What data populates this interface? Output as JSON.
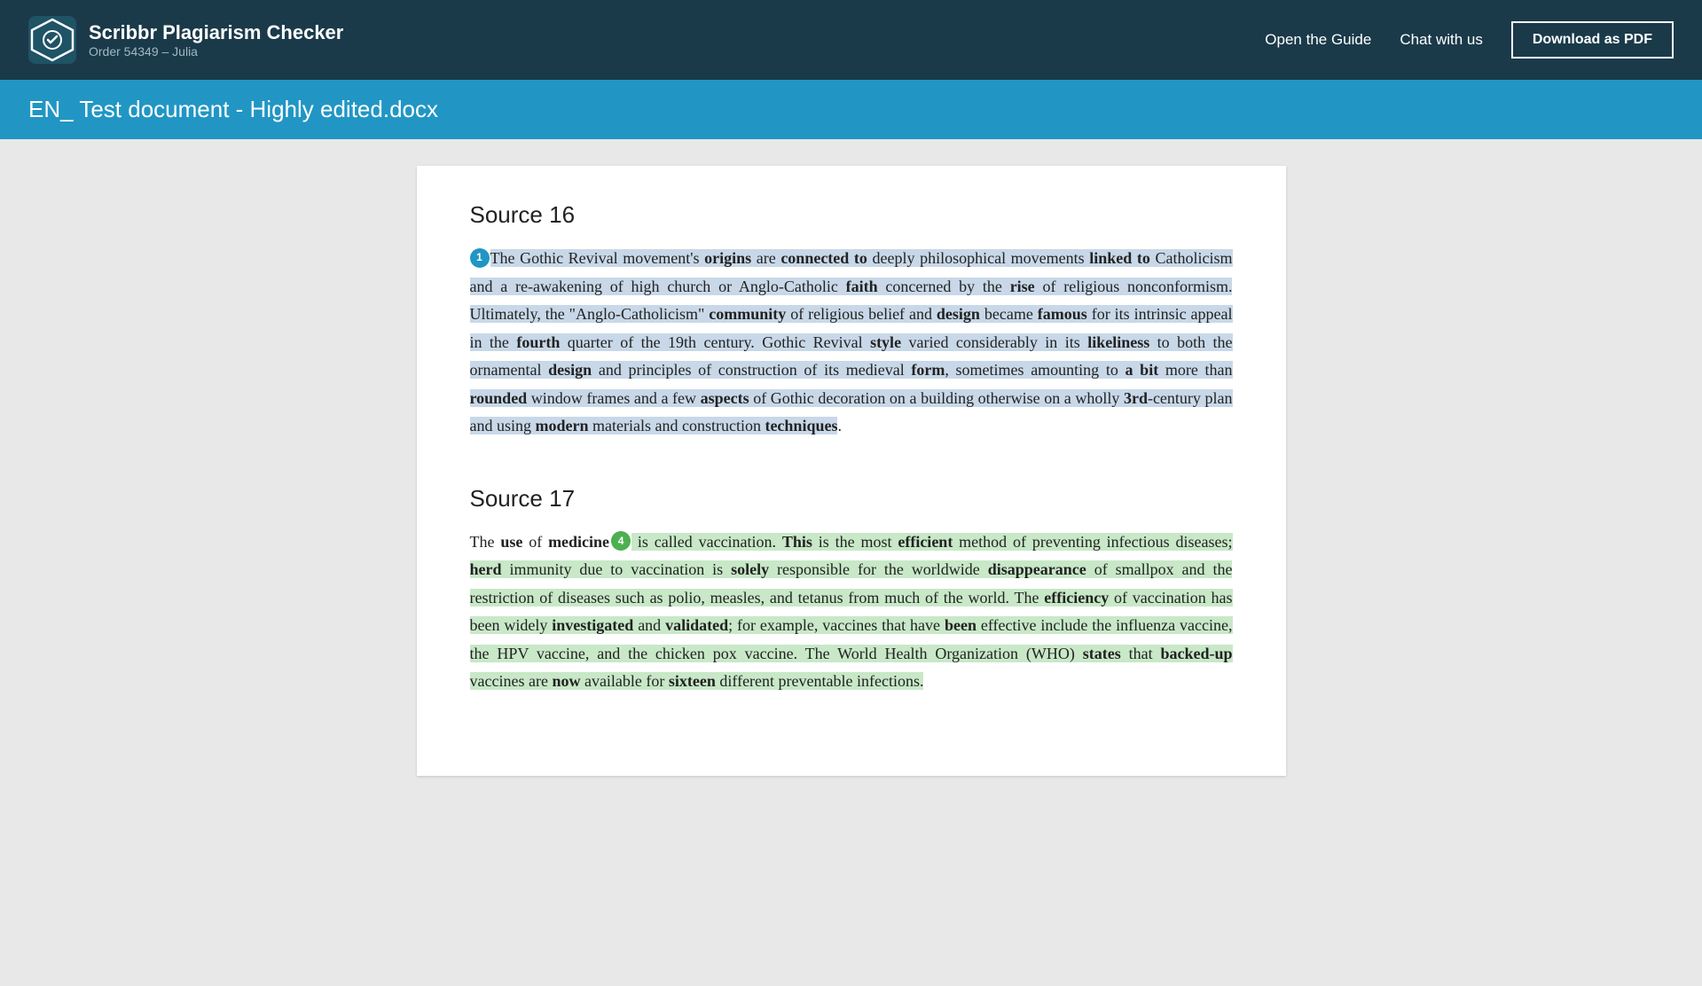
{
  "header": {
    "logo_title": "Scribbr Plagiarism Checker",
    "logo_subtitle": "Order 54349 – Julia",
    "nav": {
      "guide_label": "Open the Guide",
      "chat_label": "Chat with us",
      "download_label": "Download as PDF"
    }
  },
  "blue_bar": {
    "title": "EN_ Test document - Highly edited.docx"
  },
  "sources": [
    {
      "id": "source16",
      "heading": "Source 16",
      "badge_number": "1",
      "badge_type": "blue",
      "paragraph_parts": [
        {
          "text": "The Gothic Revival movement's ",
          "style": "hl-blue"
        },
        {
          "text": "origins",
          "style": "hl-blue bold"
        },
        {
          "text": " are ",
          "style": "hl-blue"
        },
        {
          "text": "connected to",
          "style": "hl-blue bold"
        },
        {
          "text": " deeply philosophical movements ",
          "style": "hl-blue"
        },
        {
          "text": "linked to",
          "style": "hl-blue bold"
        },
        {
          "text": " Catholicism and a re-awakening of high church or Anglo-Catholic ",
          "style": "hl-blue"
        },
        {
          "text": "faith",
          "style": "hl-blue bold"
        },
        {
          "text": " concerned by the ",
          "style": "hl-blue"
        },
        {
          "text": "rise",
          "style": "hl-blue bold"
        },
        {
          "text": " of religious nonconformism. Ultimately, the \"Anglo-Catholicism\" ",
          "style": "hl-blue"
        },
        {
          "text": "community",
          "style": "hl-blue bold"
        },
        {
          "text": " of religious belief and ",
          "style": "hl-blue"
        },
        {
          "text": "design",
          "style": "hl-blue bold"
        },
        {
          "text": " became ",
          "style": "hl-blue"
        },
        {
          "text": "famous",
          "style": "hl-blue bold"
        },
        {
          "text": " for its intrinsic appeal in the ",
          "style": "hl-blue"
        },
        {
          "text": "fourth",
          "style": "hl-blue bold"
        },
        {
          "text": " quarter of the 19th century. Gothic Revival ",
          "style": "hl-blue"
        },
        {
          "text": "style",
          "style": "hl-blue bold"
        },
        {
          "text": " varied considerably in its ",
          "style": "hl-blue"
        },
        {
          "text": "likeliness",
          "style": "hl-blue bold"
        },
        {
          "text": " to both the ornamental ",
          "style": "hl-blue"
        },
        {
          "text": "design",
          "style": "hl-blue bold"
        },
        {
          "text": " and principles of construction of its medieval ",
          "style": "hl-blue"
        },
        {
          "text": "form",
          "style": "hl-blue bold"
        },
        {
          "text": ", sometimes amounting to ",
          "style": "hl-blue"
        },
        {
          "text": "a bit",
          "style": "hl-blue bold"
        },
        {
          "text": " more than ",
          "style": "hl-blue"
        },
        {
          "text": "rounded",
          "style": "hl-blue bold"
        },
        {
          "text": " window frames and a few ",
          "style": "hl-blue"
        },
        {
          "text": "aspects",
          "style": "hl-blue bold"
        },
        {
          "text": " of Gothic decoration on a building otherwise on a wholly ",
          "style": "hl-blue"
        },
        {
          "text": "3rd",
          "style": "hl-blue bold"
        },
        {
          "text": "-century plan and using ",
          "style": "hl-blue"
        },
        {
          "text": "modern",
          "style": "hl-blue bold"
        },
        {
          "text": " materials and construction ",
          "style": "hl-blue"
        },
        {
          "text": "techniques",
          "style": "hl-blue bold"
        },
        {
          "text": ".",
          "style": "normal"
        }
      ]
    },
    {
      "id": "source17",
      "heading": "Source 17",
      "badge_number": "4",
      "badge_type": "green",
      "paragraph_parts": [
        {
          "text": "The ",
          "style": "normal"
        },
        {
          "text": "use",
          "style": "normal bold"
        },
        {
          "text": " of ",
          "style": "normal"
        },
        {
          "text": "medicine",
          "style": "normal bold"
        },
        {
          "text": " is called vaccination. ",
          "style": "hl-green"
        },
        {
          "text": "This",
          "style": "hl-green bold"
        },
        {
          "text": " is the most ",
          "style": "hl-green"
        },
        {
          "text": "efficient",
          "style": "hl-green bold"
        },
        {
          "text": " method of preventing infectious diseases; ",
          "style": "hl-green"
        },
        {
          "text": "herd",
          "style": "hl-green bold"
        },
        {
          "text": " immunity due to vaccination is ",
          "style": "hl-green"
        },
        {
          "text": "solely",
          "style": "hl-green bold"
        },
        {
          "text": " responsible for the worldwide ",
          "style": "hl-green"
        },
        {
          "text": "disappearance",
          "style": "hl-green bold"
        },
        {
          "text": " of smallpox and the restriction of diseases such as polio, measles, and tetanus from much of the world. The ",
          "style": "hl-green"
        },
        {
          "text": "efficiency",
          "style": "hl-green bold"
        },
        {
          "text": " of vaccination has been widely ",
          "style": "hl-green"
        },
        {
          "text": "investigated",
          "style": "hl-green bold"
        },
        {
          "text": " and ",
          "style": "hl-green"
        },
        {
          "text": "validated",
          "style": "hl-green bold"
        },
        {
          "text": "; for example, vaccines that have ",
          "style": "hl-green"
        },
        {
          "text": "been",
          "style": "hl-green bold"
        },
        {
          "text": " effective include the influenza vaccine, the HPV vaccine, and the chicken pox vaccine. The World Health Organization (WHO) ",
          "style": "hl-green"
        },
        {
          "text": "states",
          "style": "hl-green bold"
        },
        {
          "text": " that ",
          "style": "hl-green"
        },
        {
          "text": "backed-up",
          "style": "hl-green bold"
        },
        {
          "text": " vaccines are ",
          "style": "hl-green"
        },
        {
          "text": "now",
          "style": "hl-green bold"
        },
        {
          "text": " available for ",
          "style": "hl-green"
        },
        {
          "text": "sixteen",
          "style": "hl-green bold"
        },
        {
          "text": " different preventable infections.",
          "style": "hl-green"
        }
      ]
    }
  ]
}
